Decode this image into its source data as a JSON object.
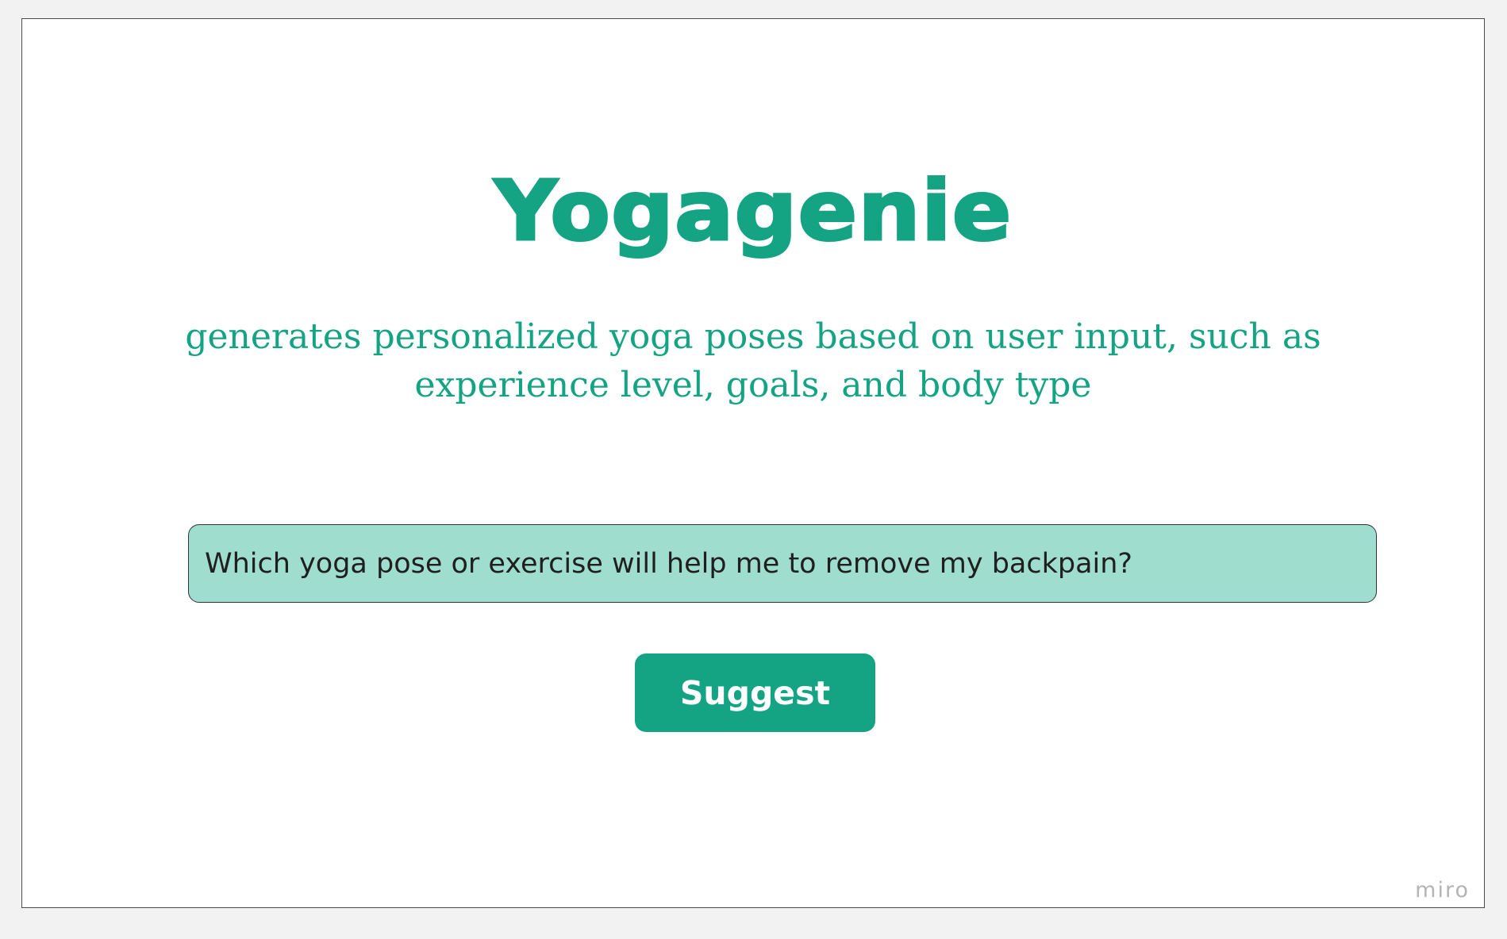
{
  "app": {
    "title": "Yogagenie",
    "tagline_line1": "generates personalized yoga poses based on user input, such as",
    "tagline_line2": "experience level, goals, and body type"
  },
  "prompt": {
    "value": "Which yoga pose or exercise will help me to remove my backpain?"
  },
  "actions": {
    "suggest_label": "Suggest"
  },
  "watermark": "miro",
  "colors": {
    "brand": "#14a383",
    "input_background": "#9fddce",
    "page_background": "#f2f2f2"
  }
}
